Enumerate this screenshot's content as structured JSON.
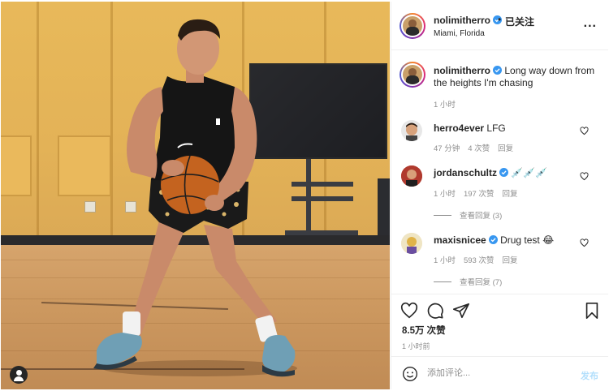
{
  "post": {
    "username": "nolimitherro",
    "follow_status": "已关注",
    "separator": "•",
    "location": "Miami, Florida",
    "more_label": "...",
    "caption": {
      "username": "nolimitherro",
      "text": "Long way down from the heights I'm chasing",
      "time": "1 小时"
    }
  },
  "comments": [
    {
      "username": "herro4ever",
      "text": "LFG",
      "time": "47 分钟",
      "likes": "4 次赞",
      "reply": "回复",
      "view_replies": ""
    },
    {
      "username": "jordanschultz",
      "text": "💉💉💉",
      "time": "1 小时",
      "likes": "197 次赞",
      "reply": "回复",
      "view_replies": "查看回复 (3)"
    },
    {
      "username": "maxisnicee",
      "text": "Drug test 😂",
      "time": "1 小时",
      "likes": "593 次赞",
      "reply": "回复",
      "view_replies": "查看回复 (7)"
    }
  ],
  "footer": {
    "likes": "8.5万 次赞",
    "time": "1 小时前",
    "add_comment_placeholder": "添加评论...",
    "post_label": "发布"
  },
  "colors": {
    "verified": "#3897f0",
    "text": "#262626",
    "muted": "#8e8e8e",
    "post_disabled": "#b2dffc",
    "border": "#efefef"
  },
  "icons": [
    "more-icon",
    "verified-icon",
    "heart-icon",
    "comment-icon",
    "share-icon",
    "bookmark-icon",
    "emoji-icon",
    "user-tag-icon"
  ]
}
